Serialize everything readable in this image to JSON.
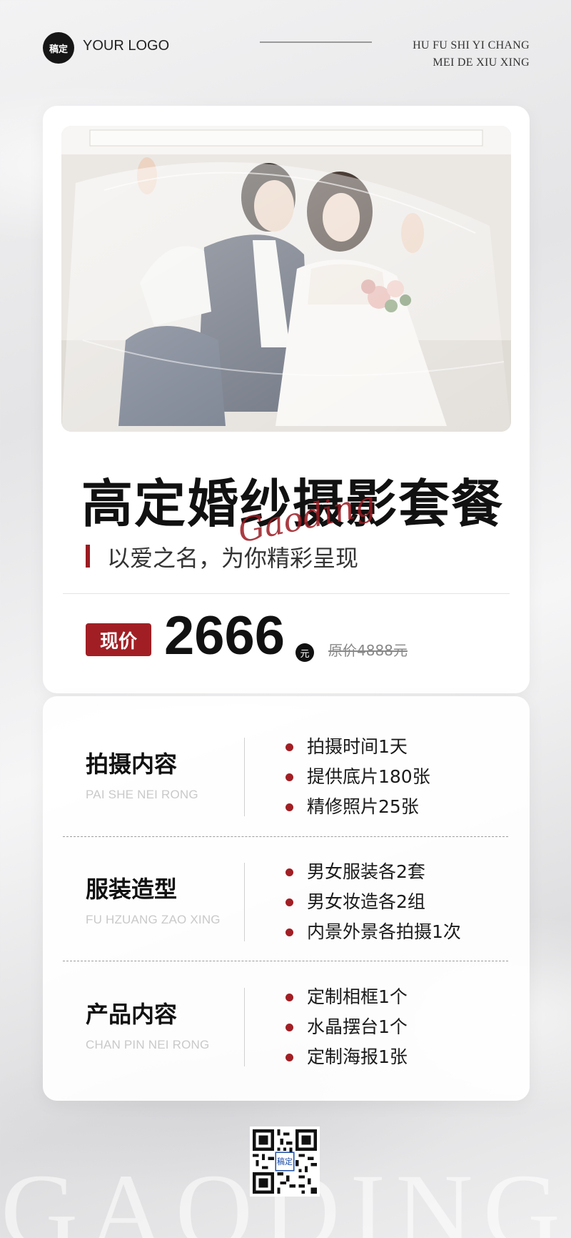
{
  "header": {
    "logo_badge": "稿定",
    "logo_text": "YOUR LOGO",
    "tagline_line1": "HU FU SHI YI CHANG",
    "tagline_line2": "MEI DE XIU XING"
  },
  "hero": {
    "title": "高定婚纱摄影套餐",
    "script_word": "Gaoding",
    "subtitle": "以爱之名，为你精彩呈现"
  },
  "price": {
    "label": "现价",
    "value": "2666",
    "unit": "元",
    "original": "原价4888元"
  },
  "details": [
    {
      "title": "拍摄内容",
      "subtitle": "PAI SHE NEI RONG",
      "items": [
        "拍摄时间1天",
        "提供底片180张",
        "精修照片25张"
      ]
    },
    {
      "title": "服装造型",
      "subtitle": "FU HZUANG ZAO XING",
      "items": [
        "男女服装各2套",
        "男女妆造各2组",
        "内景外景各拍摄1次"
      ]
    },
    {
      "title": "产品内容",
      "subtitle": "CHAN PIN NEI RONG",
      "items": [
        "定制相框1个",
        "水晶摆台1个",
        "定制海报1张"
      ]
    }
  ],
  "qr": {
    "center_label": "稿定"
  },
  "watermark": "GAODING",
  "colors": {
    "accent": "#a11f24",
    "text": "#111111",
    "muted": "#c9c9c9"
  },
  "photo_icon": "wedding-photo"
}
